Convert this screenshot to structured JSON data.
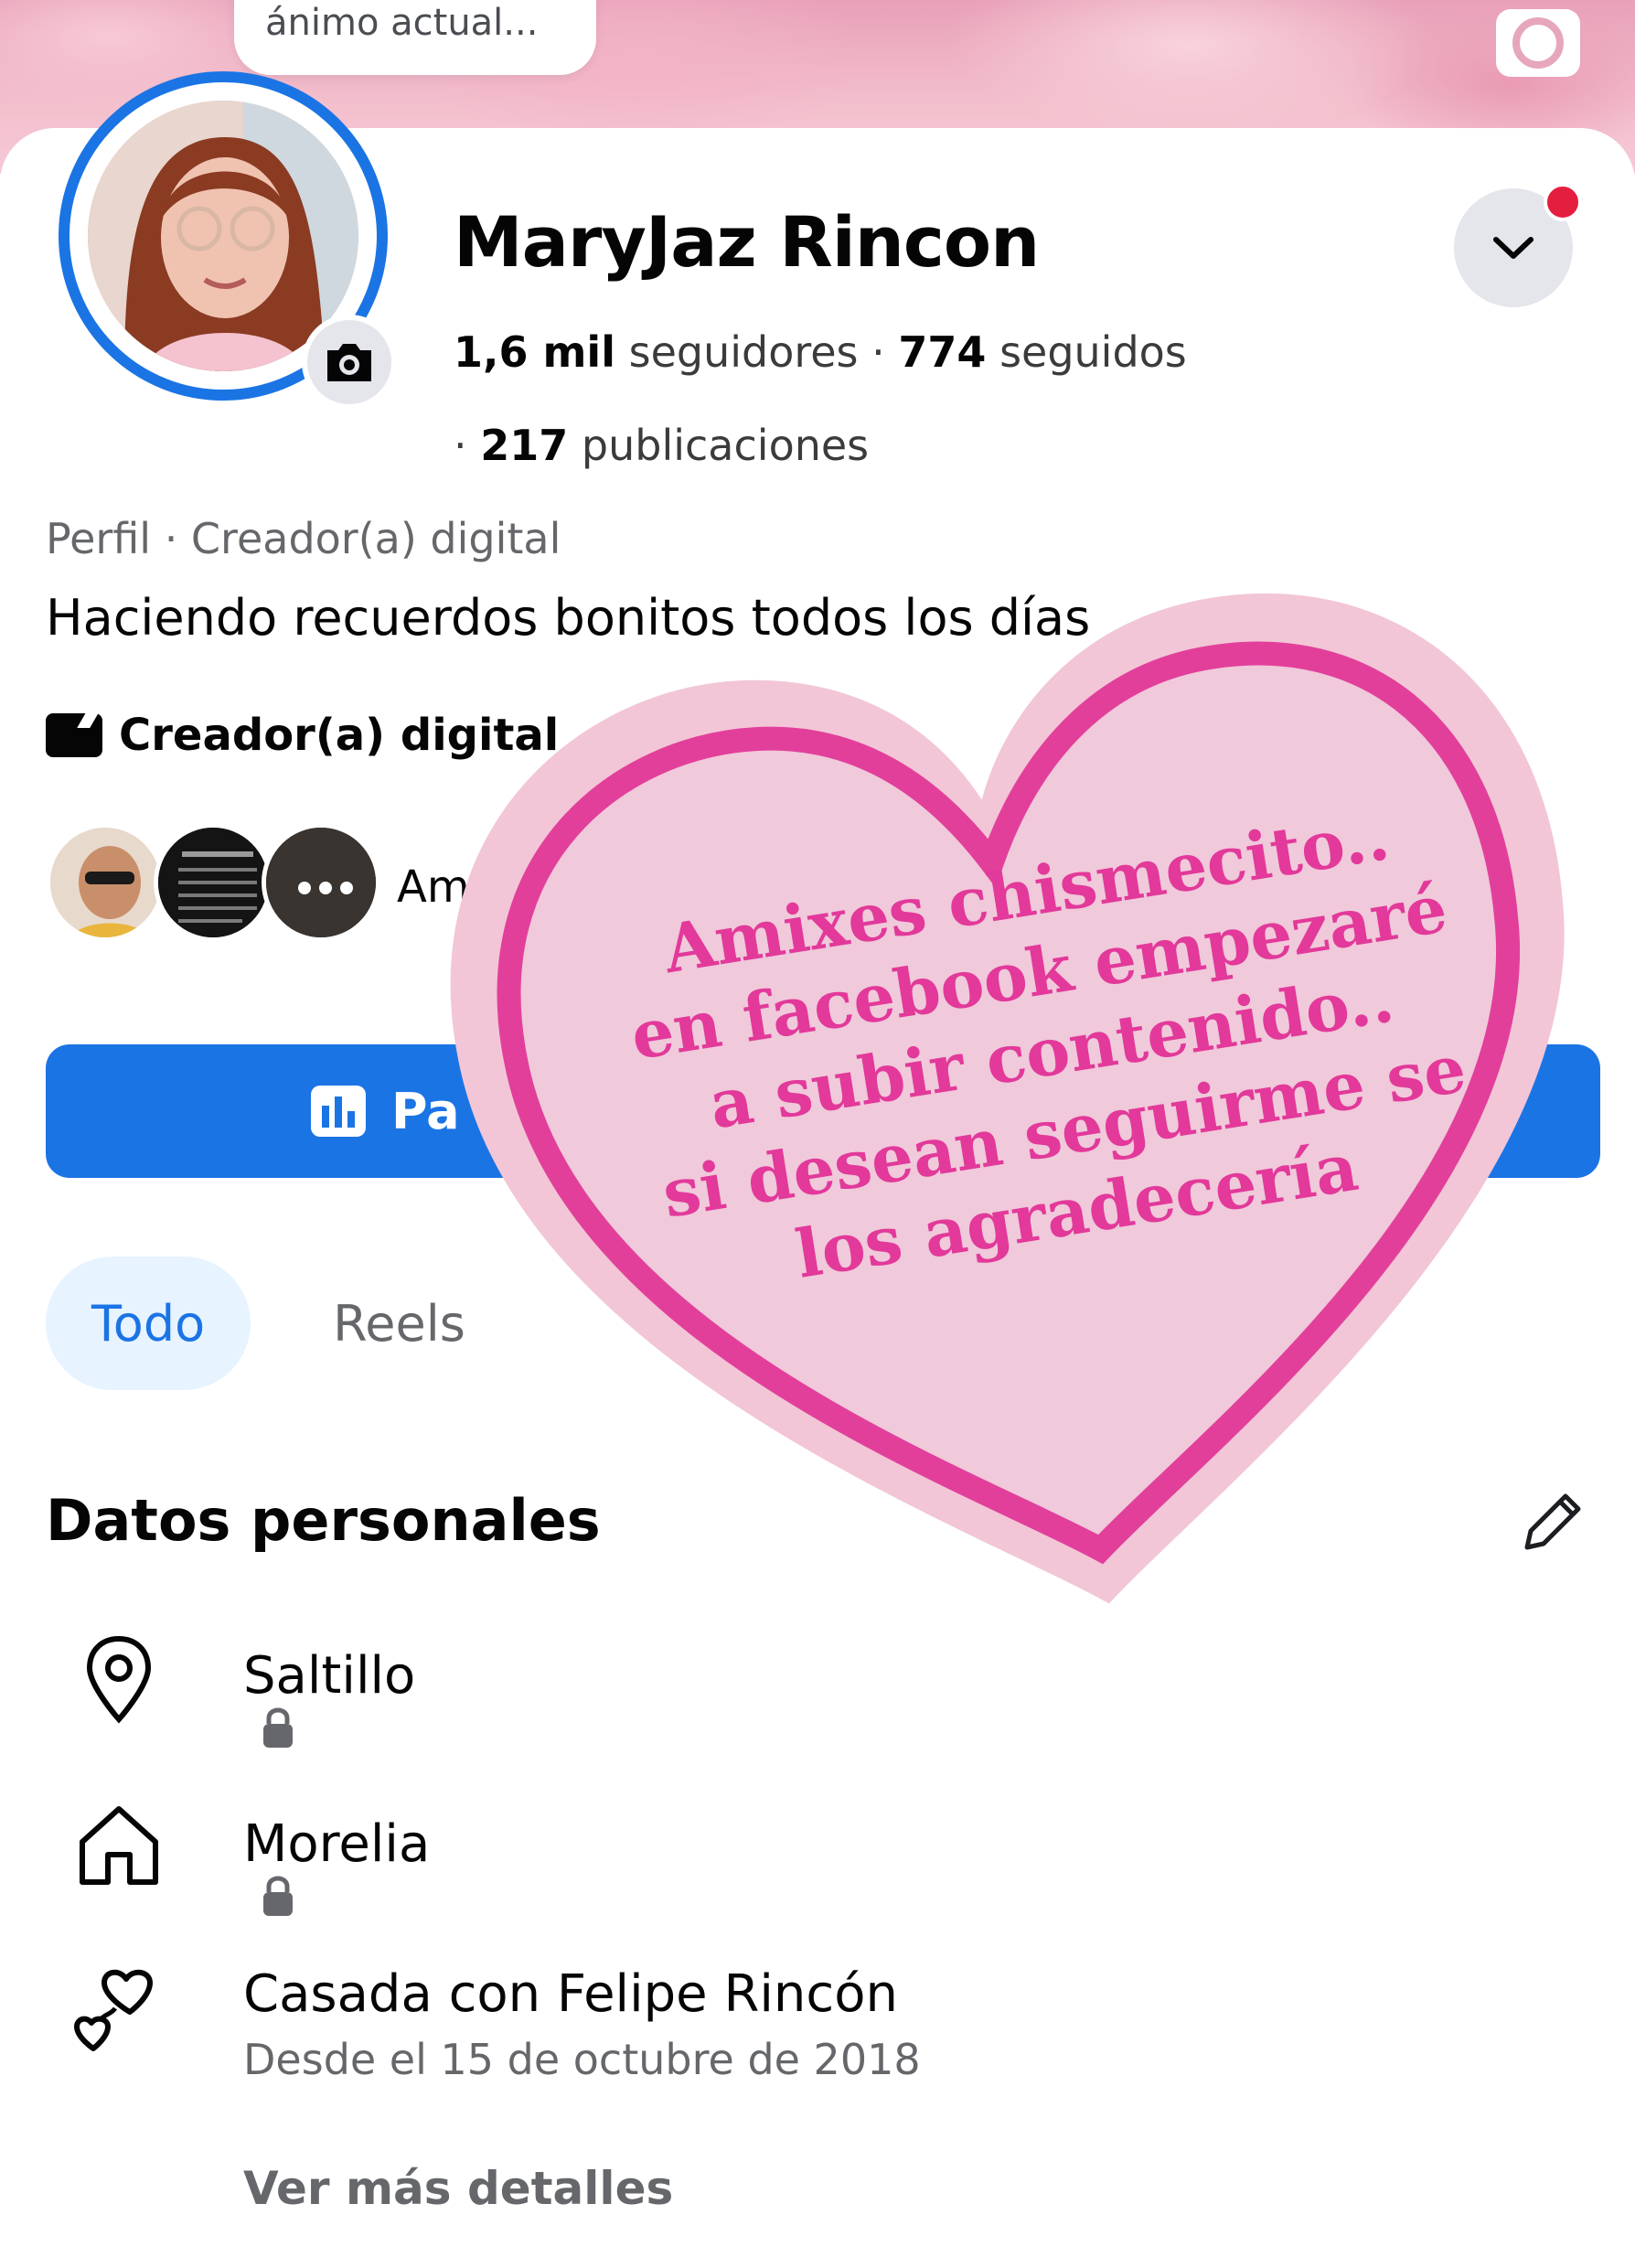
{
  "mood": {
    "text": "ánimo actual..."
  },
  "profile": {
    "name": "MaryJaz Rincon",
    "followers_count": "1,6 mil",
    "followers_label": "seguidores",
    "following_count": "774",
    "following_label": "seguidos",
    "posts_count": "217",
    "posts_label": "publicaciones",
    "category": "Perfil · Creador(a) digital",
    "bio": "Haciendo recuerdos bonitos todos los días",
    "creator_label": "Creador(a) digital",
    "friends_label": "Amis"
  },
  "professional_button": {
    "label": "Pa"
  },
  "tabs": [
    {
      "label": "Todo",
      "active": true
    },
    {
      "label": "Reels",
      "active": false
    }
  ],
  "personal": {
    "title": "Datos personales",
    "items": [
      {
        "icon": "location-pin-icon",
        "text": "Saltillo",
        "locked": true
      },
      {
        "icon": "home-icon",
        "text": "Morelia",
        "locked": true
      },
      {
        "icon": "hearts-icon",
        "text": "Casada con Felipe Rincón",
        "sub": "Desde el 15 de octubre de 2018"
      }
    ],
    "more_label": "Ver más detalles"
  },
  "sticker": {
    "lines": [
      "Amixes  chismecito..",
      "en facebook empezaré",
      "a subir contenido..",
      "si desean seguirme se",
      "los agradecería"
    ],
    "colors": {
      "outer": "#f3c9d9",
      "border": "#e23f9b",
      "text": "#e2399a"
    }
  },
  "colors": {
    "accent": "#1b74e4",
    "notification": "#e41e3f"
  }
}
